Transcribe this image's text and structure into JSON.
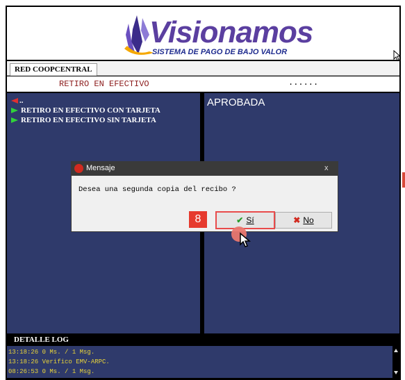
{
  "banner": {
    "logo_word": "Visionamos",
    "logo_subtitle": "SISTEMA DE PAGO DE BAJO VALOR"
  },
  "tabs": [
    {
      "label": "RED COOPCENTRAL"
    }
  ],
  "transaction": {
    "title": "RETIRO EN EFECTIVO",
    "field_value": "......"
  },
  "menu": {
    "back_label": "..",
    "options": [
      {
        "label": "RETIRO EN EFECTIVO CON TARJETA"
      },
      {
        "label": "RETIRO EN EFECTIVO SIN TARJETA"
      }
    ]
  },
  "status_panel": {
    "status": "APROBADA"
  },
  "dialog": {
    "title": "Mensaje",
    "close": "x",
    "message": "Desea una segunda copia del recibo ?",
    "yes_label": "Sí",
    "no_label": "No"
  },
  "annotation": {
    "step_number": "8"
  },
  "log": {
    "title": "DETALLE LOG",
    "lines": [
      "13:18:26 0 Ms. / 1 Msg.",
      "13:18:26 Verifico EMV-ARPC.",
      "08:26:53 0 Ms. / 1 Msg."
    ]
  },
  "colors": {
    "panel_bg": "#2f3a6b",
    "log_text": "#e7d33a",
    "brand_purple": "#5b3fa0",
    "highlight": "#e84b4b"
  }
}
